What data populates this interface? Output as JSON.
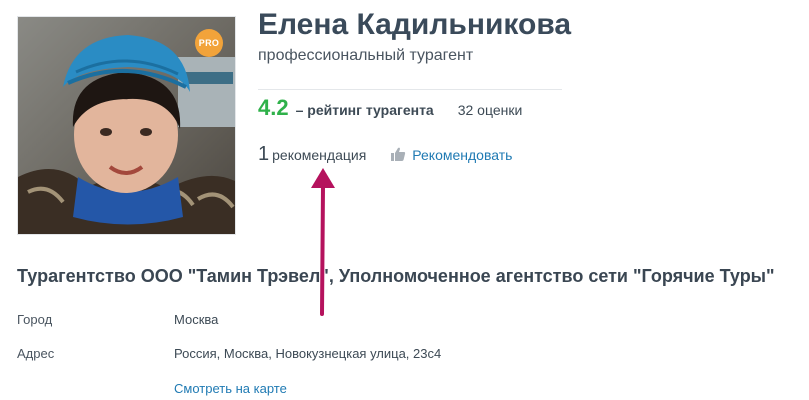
{
  "profile": {
    "name": "Елена Кадильникова",
    "role": "профессиональный турагент",
    "badge": "PRO",
    "badge_color": "#f2a33a"
  },
  "rating": {
    "value": "4.2",
    "label": "– рейтинг турагента",
    "reviews": "32 оценки",
    "value_color": "#2fb14a"
  },
  "recommendations": {
    "count": "1",
    "label": "рекомендация",
    "button_label": "Рекомендовать",
    "button_icon": "thumbs-up-icon"
  },
  "agency": {
    "title": "Турагентство ООО \"Тамин Трэвел\", Уполномоченное агентство сети \"Горячие Туры\""
  },
  "details": {
    "city_label": "Город",
    "city_value": "Москва",
    "address_label": "Адрес",
    "address_value": "Россия, Москва, Новокузнецкая улица, 23с4",
    "map_link": "Смотреть на карте"
  },
  "colors": {
    "link": "#1f7ab3",
    "annotation_arrow": "#b5125d"
  }
}
